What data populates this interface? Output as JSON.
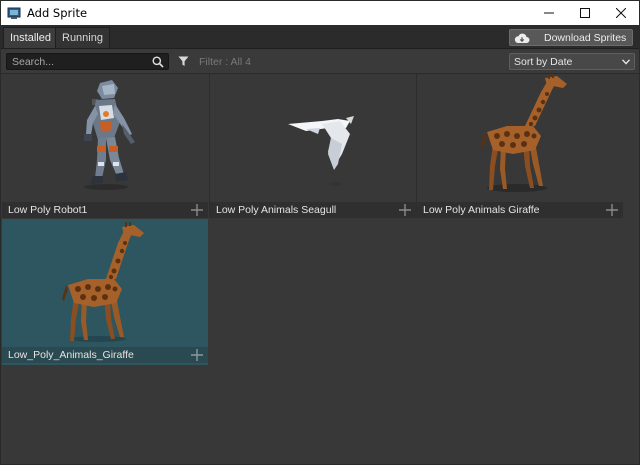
{
  "window": {
    "title": "Add Sprite",
    "buttons": [
      "minimize-icon",
      "maximize-icon",
      "close-icon"
    ]
  },
  "tabs": [
    {
      "label": "Installed",
      "active": true
    },
    {
      "label": "Running",
      "active": false
    }
  ],
  "toolbar": {
    "download_label": "Download Sprites",
    "download_icon": "cloud-download-icon"
  },
  "filterbar": {
    "search_placeholder": "Search...",
    "search_value": "",
    "search_icon": "magnifier-icon",
    "filter_icon": "funnel-icon",
    "filter_text": "Filter : All 4",
    "sort_selected": "Sort by Date"
  },
  "sprites": [
    {
      "name": "Low Poly Robot1",
      "thumbnail": "robot",
      "selected": false
    },
    {
      "name": "Low Poly Animals Seagull",
      "thumbnail": "seagull",
      "selected": false
    },
    {
      "name": "Low Poly Animals Giraffe",
      "thumbnail": "giraffe",
      "selected": false
    },
    {
      "name": "Low_Poly_Animals_Giraffe",
      "thumbnail": "giraffe",
      "selected": true
    }
  ],
  "colors": {
    "panel": "#383838",
    "selected_tile": "#2e5660",
    "caption_bar": "#2f2f2f"
  }
}
